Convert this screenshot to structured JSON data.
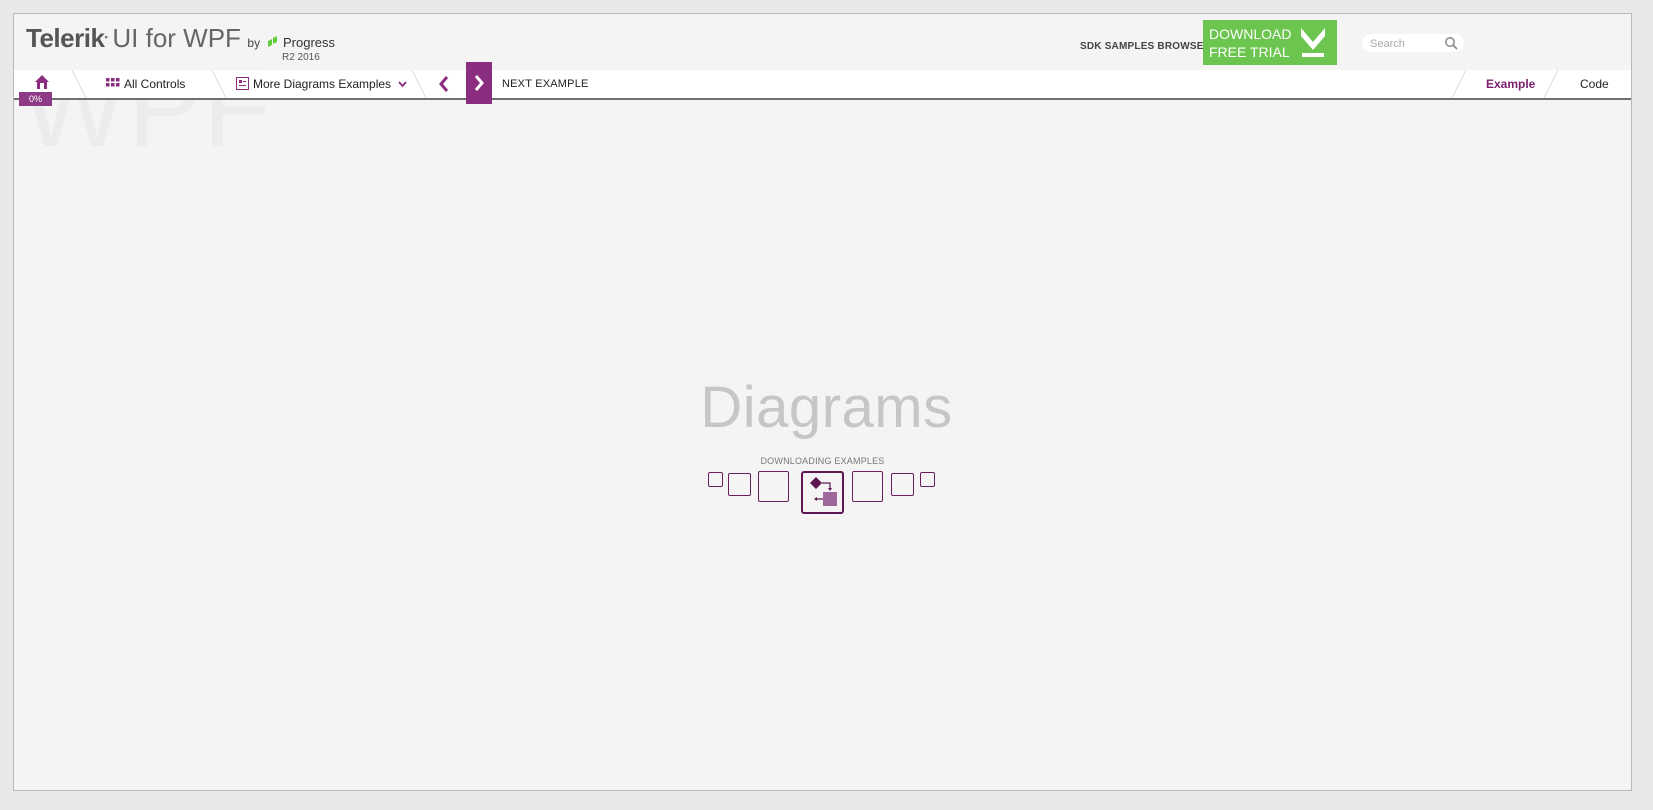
{
  "header": {
    "brand_telerik": "Telerik",
    "brand_product": "UI for WPF",
    "brand_by": "by",
    "brand_company": "Progress",
    "release": "R2 2016",
    "sdk_label": "SDK SAMPLES BROWSER",
    "download_line1": "DOWNLOAD",
    "download_line2": "FREE TRIAL",
    "search_placeholder": "Search"
  },
  "toolbar": {
    "home_progress": "0%",
    "all_controls": "All Controls",
    "more_examples": "More Diagrams Examples",
    "next_example": "NEXT EXAMPLE",
    "tab_example": "Example",
    "tab_code": "Code",
    "watermark": "WPF"
  },
  "loading": {
    "title": "Diagrams",
    "status": "DOWNLOADING EXAMPLES"
  },
  "colors": {
    "accent": "#8b2d7f",
    "download_green": "#6bc54f",
    "loader_border": "#6b1e5f"
  },
  "icons": {
    "home": "home-icon",
    "all_controls": "grid-icon",
    "more_examples": "examples-icon",
    "chevron": "chevron-down-icon",
    "prev": "chevron-left-icon",
    "next": "chevron-right-icon",
    "download": "download-arrow-icon",
    "search": "search-icon",
    "diagram": "diagram-shapes-icon"
  }
}
